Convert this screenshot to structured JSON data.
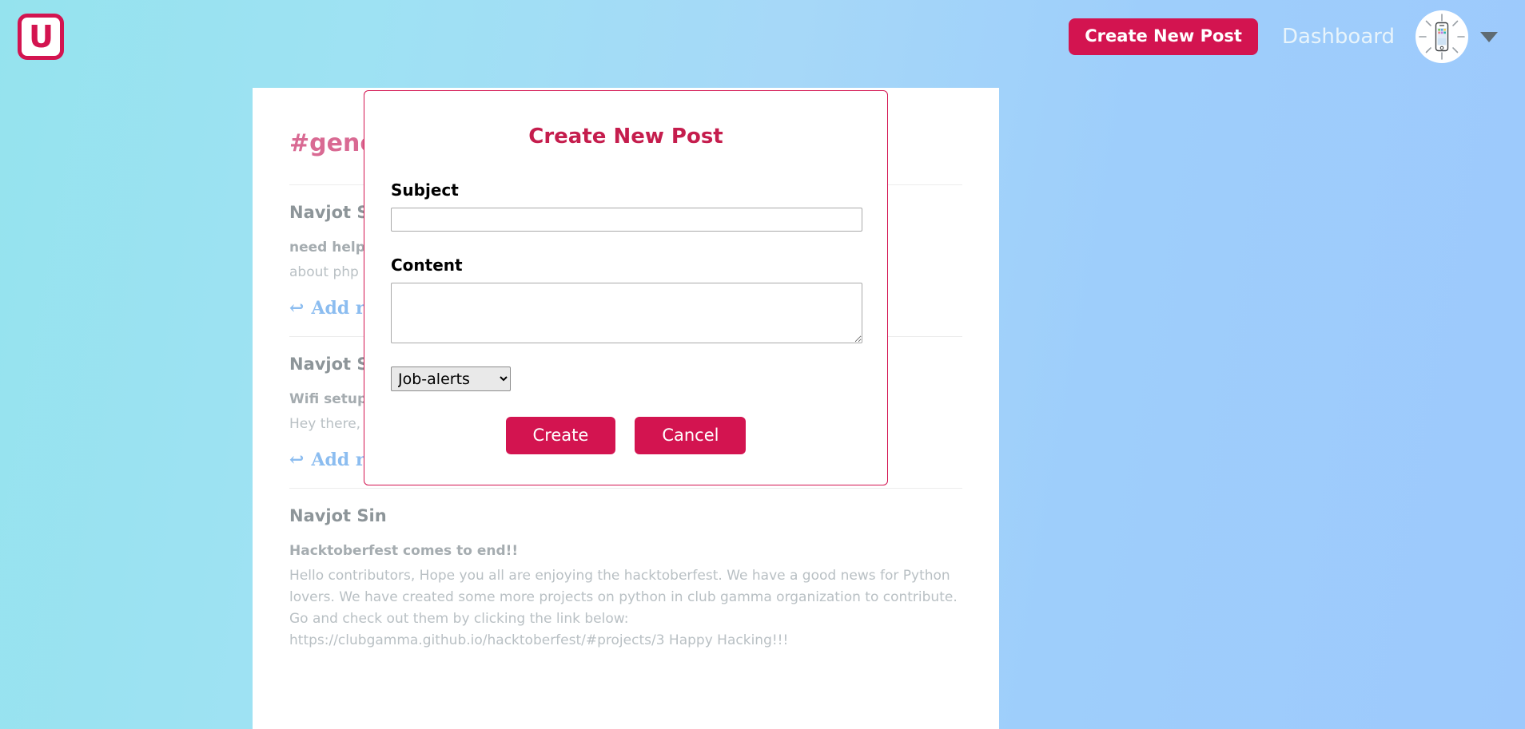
{
  "nav": {
    "logo_letter": "U",
    "create_post_label": "Create New Post",
    "dashboard_label": "Dashboard",
    "avatar_alt": "smartphone-avatar"
  },
  "page": {
    "channel_title": "#general",
    "posts": [
      {
        "author": "Navjot Sin",
        "subject": "need help",
        "body": "about php",
        "reply_label": "Add reply"
      },
      {
        "author": "Navjot Sin",
        "subject": "Wifi setup i",
        "body": "Hey there, c",
        "reply_label": "Add reply"
      },
      {
        "author": "Navjot Sin",
        "subject": "Hacktoberfest comes to end!!",
        "body": "Hello contributors, Hope you all are enjoying the hacktoberfest. We have a good news for Python lovers. We have created some more projects on python in club gamma organization to contribute. Go and check out them by clicking the link below: https://clubgamma.github.io/hacktoberfest/#projects/3 Happy Hacking!!!",
        "reply_label": "Add reply"
      }
    ]
  },
  "modal": {
    "title": "Create New Post",
    "subject_label": "Subject",
    "subject_value": "",
    "subject_placeholder": "",
    "content_label": "Content",
    "content_value": "",
    "content_placeholder": "",
    "channel_selected": "Job-alerts",
    "channel_options": [
      "Job-alerts"
    ],
    "create_label": "Create",
    "cancel_label": "Cancel"
  },
  "colors": {
    "brand_crimson": "#d31450",
    "title_crimson": "#c51d4d",
    "channel_pink": "#d96a93",
    "reply_blue": "#8cbdf0",
    "bg_left": "#95e3ee",
    "bg_right": "#9dc9fc"
  }
}
